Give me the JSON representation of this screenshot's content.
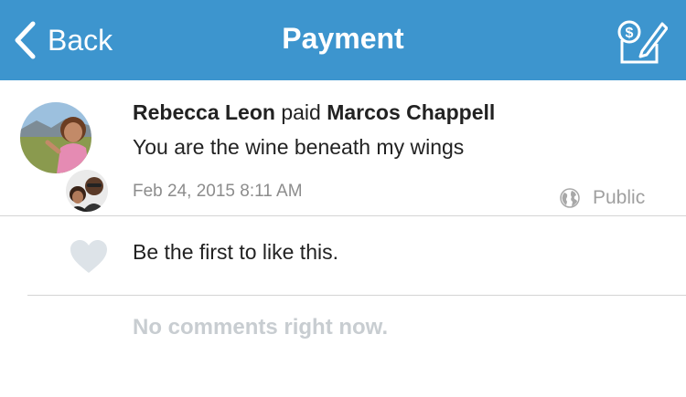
{
  "nav": {
    "back_label": "Back",
    "title": "Payment",
    "compose_icon": "pay-or-request-icon",
    "bg_color": "#3d95ce"
  },
  "story": {
    "payer": "Rebecca Leon",
    "verb": "paid",
    "payee": "Marcos Chappell",
    "note": "You are the wine beneath my wings",
    "date": "Feb 24, 2015 8:11 AM",
    "audience": "Public",
    "audience_icon": "globe-icon"
  },
  "likes": {
    "text": "Be the first to like this.",
    "icon": "heart-icon"
  },
  "comments": {
    "empty_text": "No comments right now."
  }
}
